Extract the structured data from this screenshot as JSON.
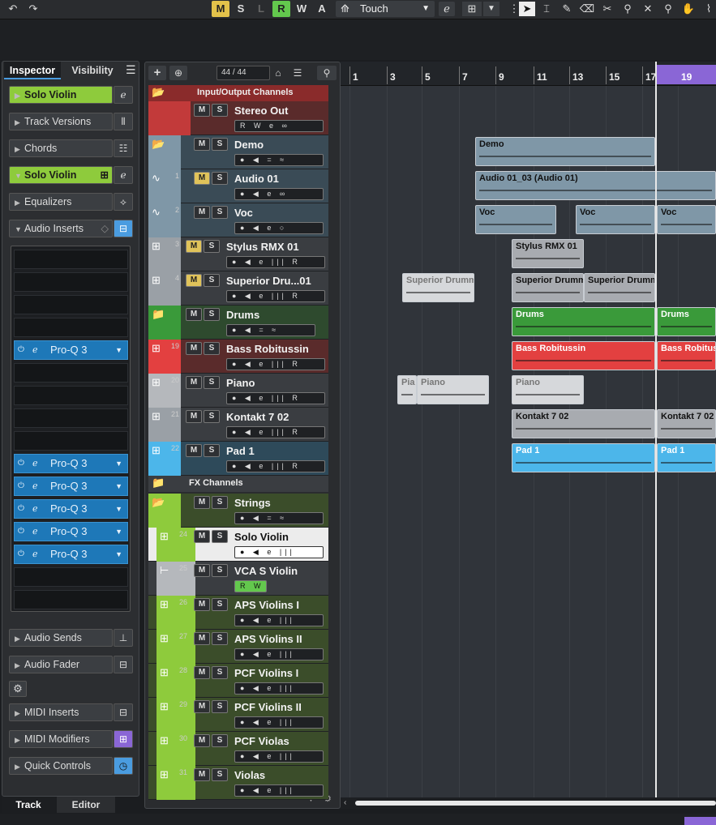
{
  "toolbar": {
    "modes": [
      "M",
      "S",
      "L",
      "R",
      "W",
      "A"
    ],
    "automation_mode": "Touch",
    "mode_colors": {
      "M": "#e3c24a",
      "R": "#63c84d",
      "W": "#3a3d41"
    }
  },
  "inspector": {
    "tabs": [
      "Inspector",
      "Visibility"
    ],
    "track_name": "Solo Violin",
    "sections": [
      "Track Versions",
      "Chords"
    ],
    "channel_name": "Solo Violin",
    "equalizers": "Equalizers",
    "audio_inserts": "Audio Inserts",
    "insert_slots": [
      "",
      "",
      "",
      "",
      "Pro-Q 3",
      "",
      "",
      "",
      "",
      "Pro-Q 3",
      "Pro-Q 3",
      "Pro-Q 3",
      "Pro-Q 3",
      "Pro-Q 3",
      "",
      ""
    ],
    "bottom_sections": [
      "Audio Sends",
      "Audio Fader",
      "MIDI Inserts",
      "MIDI Modifiers",
      "Quick Controls"
    ],
    "bottom_tabs": [
      "Track",
      "Editor"
    ]
  },
  "tracklist": {
    "counter": "44 / 44",
    "io_header": "Input/Output Channels",
    "fx_header": "FX Channels",
    "tracks": [
      {
        "num": "",
        "name": "Stereo Out",
        "ctrl": "R W e ∞"
      },
      {
        "num": "",
        "name": "Demo",
        "ctrl": "● ◀ = ≈"
      },
      {
        "num": "1",
        "name": "Audio 01",
        "ctrl": "● ◀ e ∞"
      },
      {
        "num": "2",
        "name": "Voc",
        "ctrl": "● ◀ e ○"
      },
      {
        "num": "3",
        "name": "Stylus RMX 01",
        "ctrl": "● ◀ e ||| R"
      },
      {
        "num": "4",
        "name": "Superior Dru...01",
        "ctrl": "● ◀ e ||| R"
      },
      {
        "num": "",
        "name": "Drums",
        "ctrl": "● ◀ = ≈"
      },
      {
        "num": "19",
        "name": "Bass Robitussin",
        "ctrl": "● ◀ e ||| R"
      },
      {
        "num": "20",
        "name": "Piano",
        "ctrl": "● ◀ e ||| R"
      },
      {
        "num": "21",
        "name": "Kontakt 7 02",
        "ctrl": "● ◀ e ||| R"
      },
      {
        "num": "22",
        "name": "Pad 1",
        "ctrl": "● ◀ e ||| R"
      },
      {
        "num": "",
        "name": "Strings",
        "ctrl": "● ◀ = ≈"
      },
      {
        "num": "24",
        "name": "Solo Violin",
        "ctrl": "● ◀ e |||"
      },
      {
        "num": "25",
        "name": "VCA S Violin",
        "ctrl": "R W"
      },
      {
        "num": "26",
        "name": "APS Violins I",
        "ctrl": "● ◀ e |||"
      },
      {
        "num": "27",
        "name": "APS Violins II",
        "ctrl": "● ◀ e |||"
      },
      {
        "num": "28",
        "name": "PCF Violins I",
        "ctrl": "● ◀ e |||"
      },
      {
        "num": "29",
        "name": "PCF Violins II",
        "ctrl": "● ◀ e |||"
      },
      {
        "num": "30",
        "name": "PCF Violas",
        "ctrl": "● ◀ e |||"
      },
      {
        "num": "31",
        "name": "Violas",
        "ctrl": "● ◀ e |||"
      }
    ]
  },
  "ruler": {
    "bars": [
      "1",
      "3",
      "5",
      "7",
      "9",
      "11",
      "13",
      "15",
      "17",
      "19"
    ]
  },
  "parts": [
    {
      "name": "Demo",
      "color": "#7f97a7"
    },
    {
      "name": "Audio 01_03 (Audio 01)",
      "color": "#7f97a7"
    },
    {
      "name": "Voc",
      "color": "#7f97a7"
    },
    {
      "name": "Voc",
      "color": "#7f97a7"
    },
    {
      "name": "Voc",
      "color": "#7f97a7"
    },
    {
      "name": "Stylus RMX 01",
      "color": "#a8abb0"
    },
    {
      "name": "Superior Drumm",
      "color": "#d6d8db"
    },
    {
      "name": "Superior Drumm",
      "color": "#a8abb0"
    },
    {
      "name": "Superior Drumm",
      "color": "#a8abb0"
    },
    {
      "name": "Drums",
      "color": "#3a9a3a"
    },
    {
      "name": "Drums",
      "color": "#3a9a3a"
    },
    {
      "name": "Bass Robitussin",
      "color": "#e34040"
    },
    {
      "name": "Bass Robitussin",
      "color": "#e34040"
    },
    {
      "name": "Pia",
      "color": "#d6d8db"
    },
    {
      "name": "Piano",
      "color": "#d6d8db"
    },
    {
      "name": "Piano",
      "color": "#d6d8db"
    },
    {
      "name": "Kontakt 7 02",
      "color": "#a8abb0"
    },
    {
      "name": "Kontakt 7 02",
      "color": "#a8abb0"
    },
    {
      "name": "Pad 1",
      "color": "#4cb6ea"
    },
    {
      "name": "Pad 1",
      "color": "#4cb6ea"
    }
  ]
}
